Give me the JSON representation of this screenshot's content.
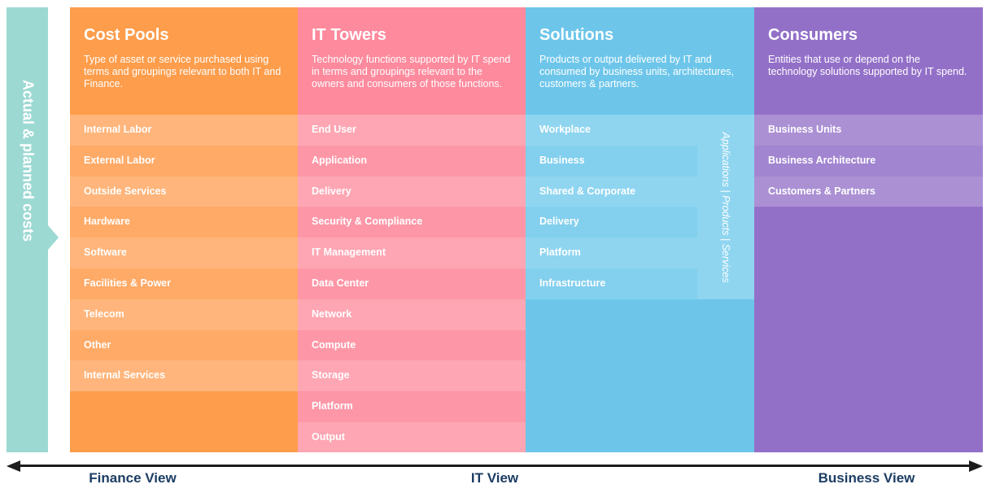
{
  "side_label": "Actual & planned costs",
  "columns": {
    "cost_pools": {
      "title": "Cost Pools",
      "description": "Type of asset or service purchased using terms and groupings relevant to both IT and Finance.",
      "items": [
        "Internal Labor",
        "External Labor",
        "Outside Services",
        "Hardware",
        "Software",
        "Facilities & Power",
        "Telecom",
        "Other",
        "Internal Services"
      ]
    },
    "it_towers": {
      "title": "IT Towers",
      "description": "Technology functions supported by IT spend in terms and groupings relevant to the owners and consumers of those functions.",
      "items": [
        "End User",
        "Application",
        "Delivery",
        "Security & Compliance",
        "IT Management",
        "Data Center",
        "Network",
        "Compute",
        "Storage",
        "Platform",
        "Output"
      ]
    },
    "solutions": {
      "title": "Solutions",
      "description": "Products or output delivered by IT and consumed by business units, architectures, customers & partners.",
      "items": [
        "Workplace",
        "Business",
        "Shared & Corporate",
        "Delivery",
        "Platform",
        "Infrastructure"
      ],
      "vertical_label": "Applications  |  Products  |  Services"
    },
    "consumers": {
      "title": "Consumers",
      "description": "Entities that use or depend on the technology solutions supported by IT spend.",
      "items": [
        "Business Units",
        "Business Architecture",
        "Customers & Partners"
      ]
    }
  },
  "axis": {
    "labels": [
      "Finance View",
      "IT View",
      "Business View"
    ]
  },
  "colors": {
    "teal": "#9dd9d3",
    "orange": "#fe9d4c",
    "pink": "#fd8a9d",
    "blue": "#6dc6ea",
    "purple": "#9370c8",
    "navy_text": "#1c3d63"
  }
}
